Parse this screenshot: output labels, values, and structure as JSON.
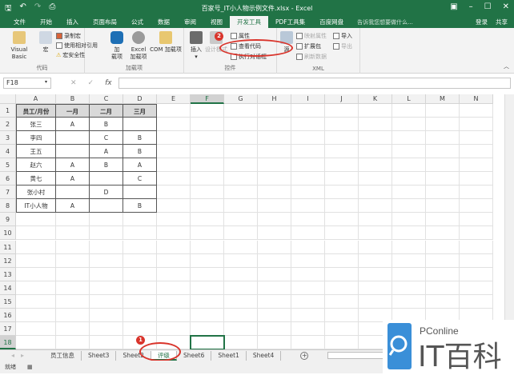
{
  "window": {
    "title": "百家号_IT小人物示例文件.xlsx - Excel",
    "qa_icons": [
      "save-icon",
      "undo-icon",
      "redo-icon",
      "print-preview-icon"
    ]
  },
  "tabs": [
    "文件",
    "开始",
    "插入",
    "页面布局",
    "公式",
    "数据",
    "审阅",
    "视图",
    "开发工具",
    "PDF工具集",
    "百度网盘"
  ],
  "active_tab": "开发工具",
  "tell_me": "告诉我您想要做什么...",
  "login": "登录",
  "share": "共享",
  "ribbon": {
    "code": {
      "label": "代码",
      "visual_basic": "Visual Basic",
      "macro": "宏",
      "record": "录制宏",
      "relative": "使用相对引用",
      "security": "宏安全性"
    },
    "addins": {
      "label": "加载项",
      "addins": "加\n载项",
      "excel_addins": "Excel\n加载项",
      "com_addins": "COM 加载项"
    },
    "controls": {
      "label": "控件",
      "insert": "插入",
      "design_mode": "设计模式",
      "properties": "属性",
      "view_code": "查看代码",
      "run_dialog": "执行对话框"
    },
    "xml": {
      "label": "XML",
      "source": "源",
      "map_props": "映射属性",
      "expansion": "扩展包",
      "refresh": "刷新数据",
      "import": "导入",
      "export": "导出"
    }
  },
  "formula": {
    "name_box": "F18",
    "cancel": "✕",
    "enter": "✓",
    "fx": "fx",
    "value": ""
  },
  "columns": [
    "A",
    "B",
    "C",
    "D",
    "E",
    "F",
    "G",
    "H",
    "I",
    "J",
    "K",
    "L",
    "M",
    "N"
  ],
  "rows": [
    "1",
    "2",
    "3",
    "4",
    "5",
    "6",
    "7",
    "8",
    "9",
    "10",
    "11",
    "12",
    "13",
    "14",
    "15",
    "16",
    "17",
    "18"
  ],
  "table": [
    [
      "员工/月份",
      "一月",
      "二月",
      "三月"
    ],
    [
      "张三",
      "A",
      "B",
      ""
    ],
    [
      "李四",
      "",
      "C",
      "B"
    ],
    [
      "王五",
      "",
      "A",
      "B"
    ],
    [
      "赵六",
      "A",
      "B",
      "A"
    ],
    [
      "黄七",
      "A",
      "",
      "C"
    ],
    [
      "张小村",
      "",
      "D",
      ""
    ],
    [
      "IT小人物",
      "A",
      "",
      "B"
    ]
  ],
  "sheets": [
    "员工信息",
    "Sheet3",
    "Sheet2",
    "评级",
    "Sheet6",
    "Sheet1",
    "Sheet4"
  ],
  "active_sheet": "评级",
  "status": "就绪",
  "annotations": {
    "step1": "1",
    "step2": "2"
  },
  "watermark": {
    "brand": "PConline",
    "name": "IT百科"
  },
  "colors": {
    "excel_green": "#217346",
    "annotation_red": "#d9342b"
  }
}
